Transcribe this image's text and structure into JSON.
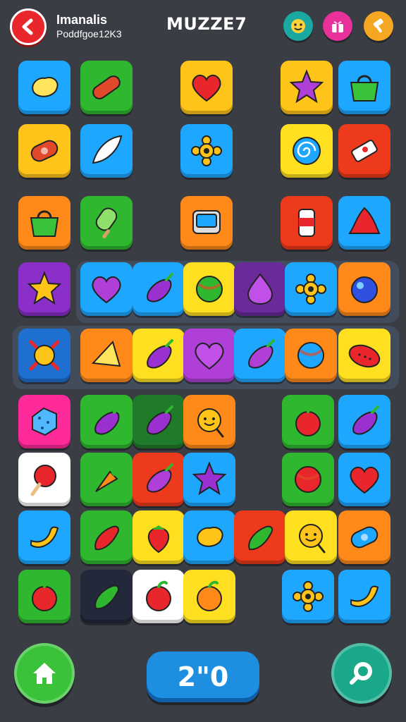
{
  "header": {
    "player_name": "Imanalis",
    "player_sub": "Poddfgoe12K3",
    "title": "MUZZE7",
    "back_icon": "chevron-left-icon",
    "buttons": [
      {
        "icon": "smiley-icon",
        "color": "#1aa8a0"
      },
      {
        "icon": "gift-icon",
        "color": "#e8319a"
      },
      {
        "icon": "hammer-icon",
        "color": "#f5a623"
      }
    ]
  },
  "board": {
    "tiles": [
      {
        "bg": "#1ea7ff",
        "icon": "bean-icon",
        "color": "#ffe45c"
      },
      {
        "bg": "#2fb82f",
        "icon": "sausage-icon",
        "color": "#e04a2a"
      },
      {
        "bg": "#ffc41a",
        "icon": "heart-icon",
        "color": "#e8262b"
      },
      {
        "bg": "#ffc41a",
        "icon": "star-icon",
        "color": "#b03fd8"
      },
      {
        "bg": "#1ea7ff",
        "icon": "basket-icon",
        "color": "#3ac23a"
      },
      {
        "bg": "#ffc41a",
        "icon": "candy-roll-icon",
        "color": "#e04a2a"
      },
      {
        "bg": "#1ea7ff",
        "icon": "leaf-icon",
        "color": "#ffffff"
      },
      {
        "bg": "#1ea7ff",
        "icon": "flower-icon",
        "color": "#ffc41a"
      },
      {
        "bg": "#ffe020",
        "icon": "swirl-candy-icon",
        "color": "#1ea7ff"
      },
      {
        "bg": "#ee3a1c",
        "icon": "rocket-icon",
        "color": "#ffffff"
      },
      {
        "bg": "#ff8a1a",
        "icon": "basket-icon",
        "color": "#3ac23a"
      },
      {
        "bg": "#2fb82f",
        "icon": "popsicle-icon",
        "color": "#8ee06a"
      },
      {
        "bg": "#ff8a1a",
        "icon": "tv-icon",
        "color": "#1ea7ff"
      },
      {
        "bg": "#ee3a1c",
        "icon": "jar-icon",
        "color": "#ffffff"
      },
      {
        "bg": "#1ea7ff",
        "icon": "bell-icon",
        "color": "#e8262b"
      },
      {
        "bg": "#8b2fc9",
        "icon": "star-icon",
        "color": "#ffc41a"
      },
      {
        "bg": "#1ea7ff",
        "icon": "heart-icon",
        "color": "#b03fd8"
      },
      {
        "bg": "#1ea7ff",
        "icon": "eggplant-icon",
        "color": "#9b30d0"
      },
      {
        "bg": "#ffe020",
        "icon": "ball-icon",
        "color": "#2fb82f"
      },
      {
        "bg": "#6a2a9a",
        "icon": "drop-icon",
        "color": "#c050e8"
      },
      {
        "bg": "#1ea7ff",
        "icon": "flower-icon",
        "color": "#ffc41a"
      },
      {
        "bg": "#ff8a1a",
        "icon": "orb-icon",
        "color": "#3050e0"
      },
      {
        "bg": "#1e6fd0",
        "icon": "sun-icon",
        "color": "#ffc41a"
      },
      {
        "bg": "#ff8a1a",
        "icon": "cheese-icon",
        "color": "#ffe45c"
      },
      {
        "bg": "#ffe020",
        "icon": "eggplant-icon",
        "color": "#9b30d0"
      },
      {
        "bg": "#b03fd8",
        "icon": "heart-icon",
        "color": "#c050e8"
      },
      {
        "bg": "#1ea7ff",
        "icon": "eggplant-icon",
        "color": "#b03fd8"
      },
      {
        "bg": "#ff8a1a",
        "icon": "ball-icon",
        "color": "#1ea7ff"
      },
      {
        "bg": "#ffe020",
        "icon": "watermelon-icon",
        "color": "#e8262b"
      },
      {
        "bg": "#ff2a9a",
        "icon": "cookie-icon",
        "color": "#4fb8ff"
      },
      {
        "bg": "#2fb82f",
        "icon": "eggplant-icon",
        "color": "#9b30d0"
      },
      {
        "bg": "#1f7a2a",
        "icon": "eggplant-icon",
        "color": "#9b30d0"
      },
      {
        "bg": "#ff8a1a",
        "icon": "smiley-icon",
        "color": "#ffc41a"
      },
      {
        "bg": "#2fb82f",
        "icon": "apple-icon",
        "color": "#e8262b"
      },
      {
        "bg": "#1ea7ff",
        "icon": "eggplant-icon",
        "color": "#9b30d0"
      },
      {
        "bg": "#ffffff",
        "icon": "lollipop-icon",
        "color": "#e8262b"
      },
      {
        "bg": "#2fb82f",
        "icon": "carrot-icon",
        "color": "#ff8a1a"
      },
      {
        "bg": "#ee3a1c",
        "icon": "eggplant-icon",
        "color": "#b03fd8"
      },
      {
        "bg": "#1ea7ff",
        "icon": "star-icon",
        "color": "#9b30d0"
      },
      {
        "bg": "#2fb82f",
        "icon": "ball-icon",
        "color": "#e8262b"
      },
      {
        "bg": "#1ea7ff",
        "icon": "heart-icon",
        "color": "#e8262b"
      },
      {
        "bg": "#1ea7ff",
        "icon": "banana-icon",
        "color": "#ffc41a"
      },
      {
        "bg": "#2fb82f",
        "icon": "pepper-icon",
        "color": "#e8262b"
      },
      {
        "bg": "#ffe020",
        "icon": "strawberry-icon",
        "color": "#e8262b"
      },
      {
        "bg": "#1ea7ff",
        "icon": "bean-icon",
        "color": "#ffc41a"
      },
      {
        "bg": "#ee3a1c",
        "icon": "pepper-icon",
        "color": "#2fb82f"
      },
      {
        "bg": "#ffe020",
        "icon": "smiley-icon",
        "color": "#ffc41a"
      },
      {
        "bg": "#ff8a1a",
        "icon": "candy-roll-icon",
        "color": "#1ea7ff"
      },
      {
        "bg": "#2fb82f",
        "icon": "apple-icon",
        "color": "#e8262b"
      },
      {
        "bg": "#23283a",
        "icon": "pepper-icon",
        "color": "#2fb82f"
      },
      {
        "bg": "#ffffff",
        "icon": "apple-icon",
        "color": "#e8262b"
      },
      {
        "bg": "#ffe020",
        "icon": "apple-icon",
        "color": "#ff8a1a"
      },
      {
        "bg": "#1ea7ff",
        "icon": "flower-icon",
        "color": "#ffc41a"
      },
      {
        "bg": "#1ea7ff",
        "icon": "banana-icon",
        "color": "#ffc41a"
      }
    ]
  },
  "footer": {
    "home_icon": "home-icon",
    "timer": "2\"0",
    "hint_icon": "magnifier-icon"
  }
}
